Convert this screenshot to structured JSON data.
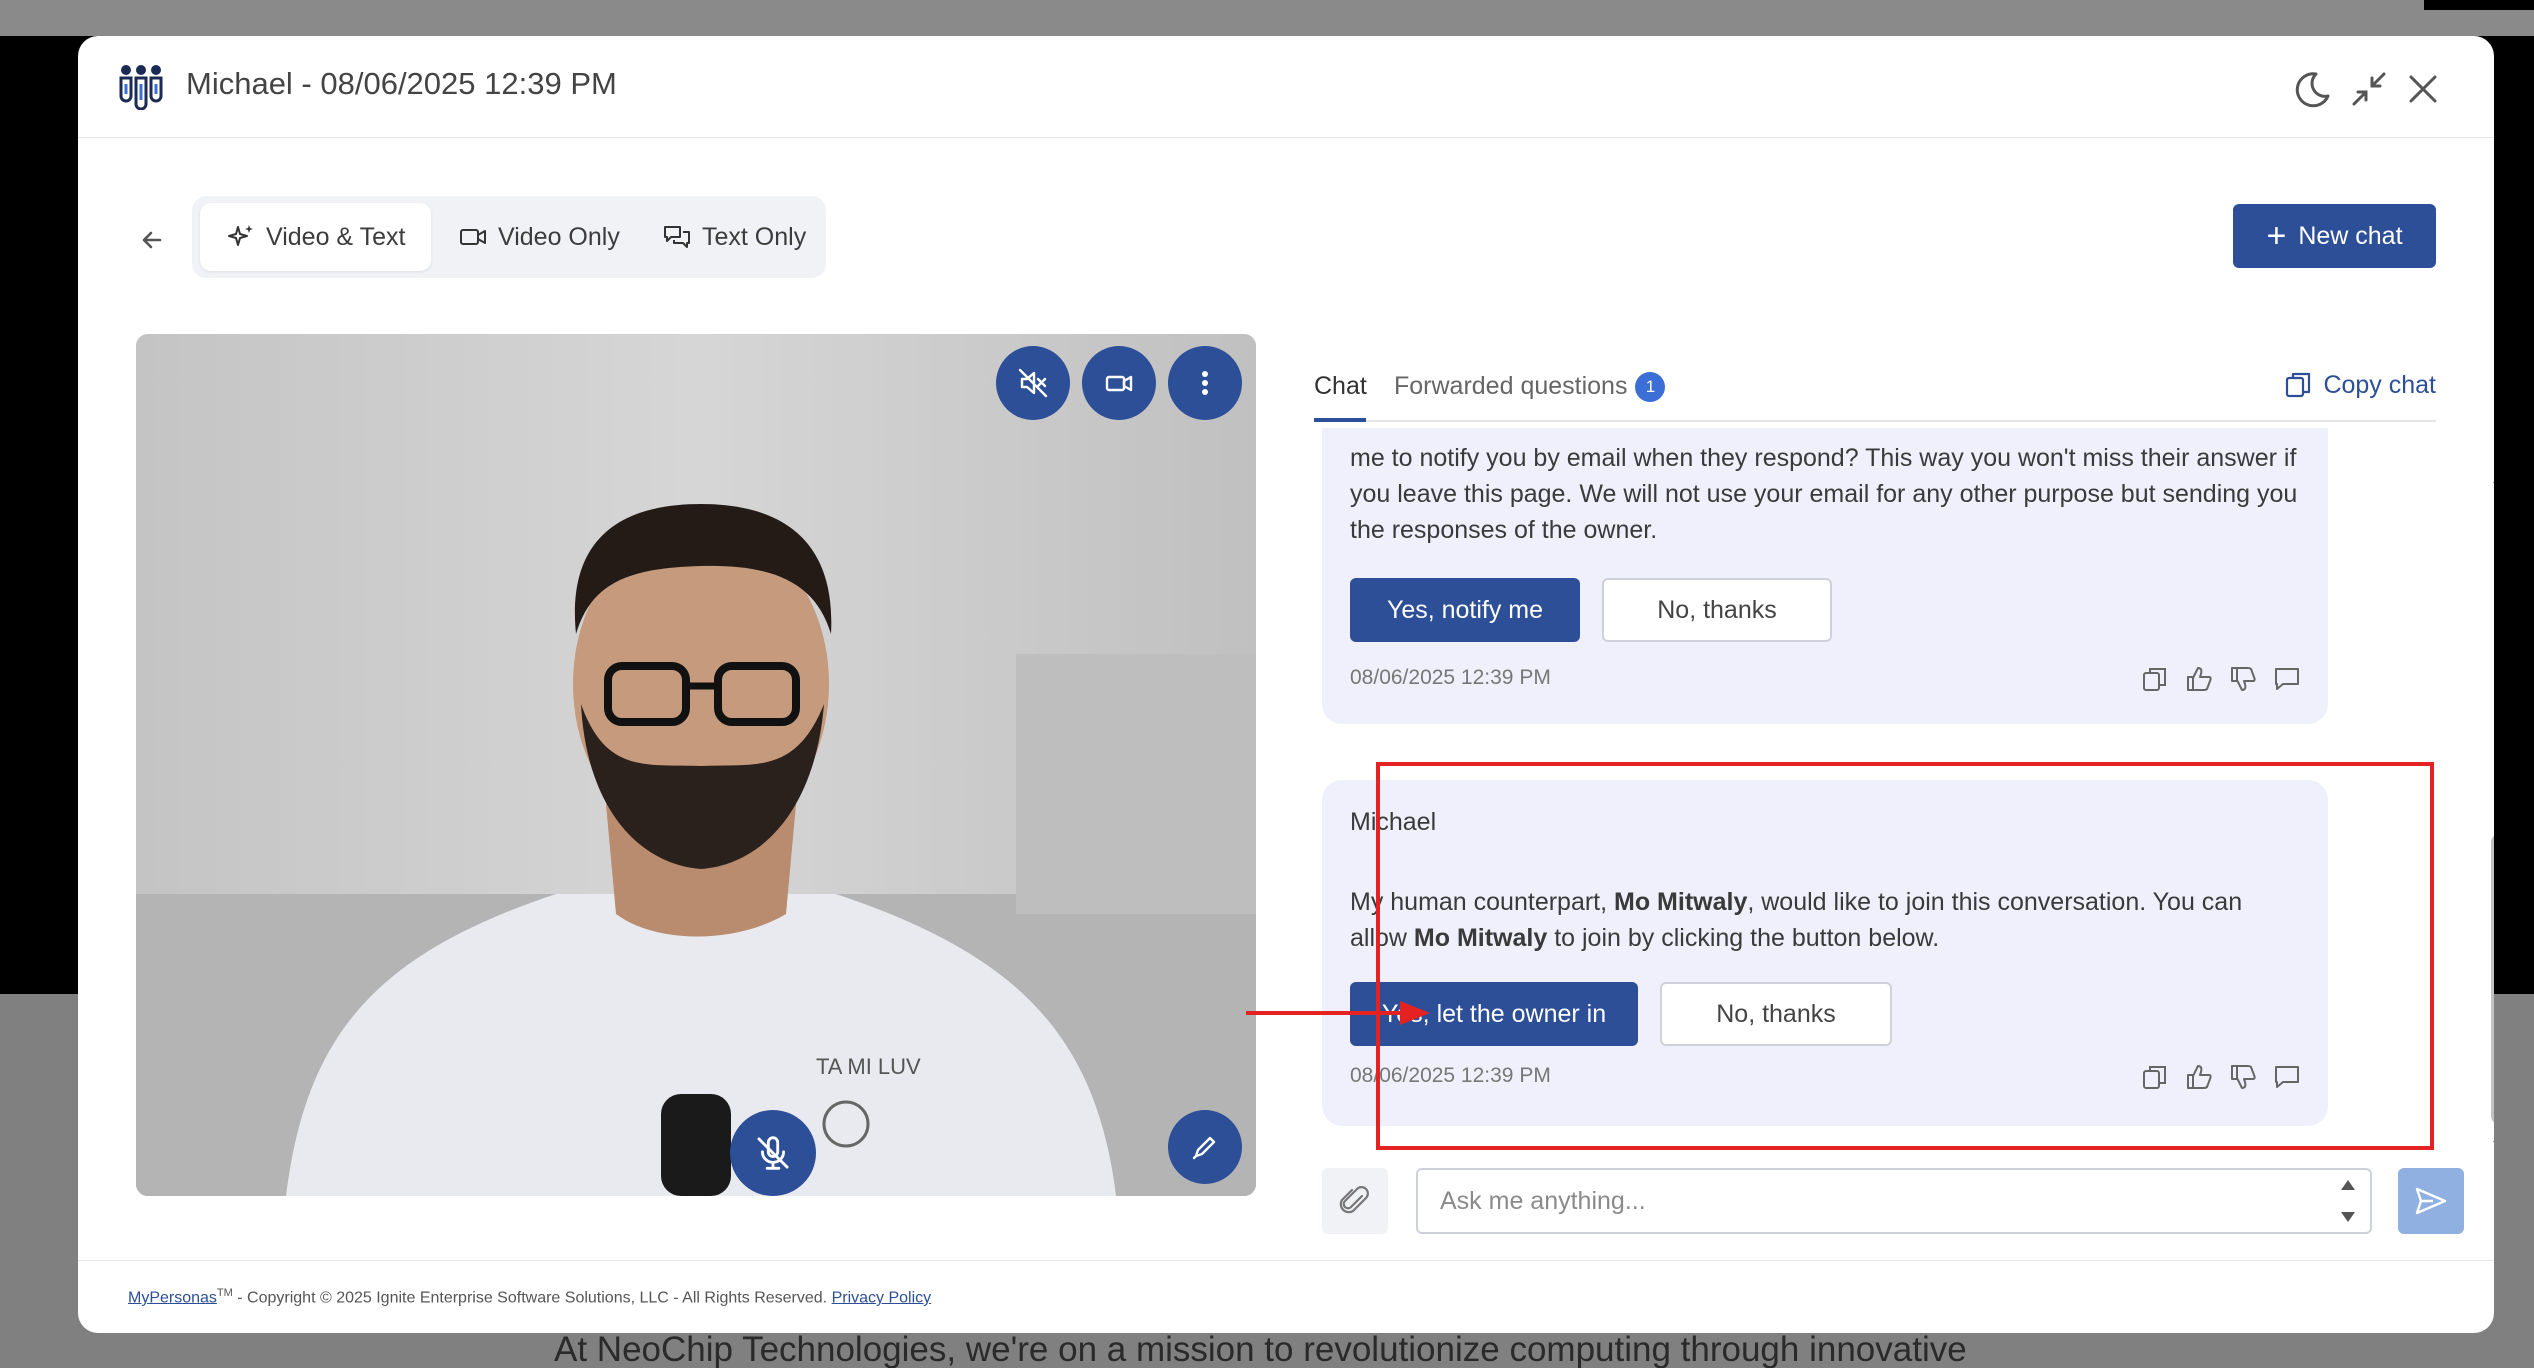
{
  "window": {
    "title": "Michael - 08/06/2025 12:39 PM"
  },
  "modes": [
    {
      "label": "Video & Text",
      "icon": "sparkles-icon",
      "active": true
    },
    {
      "label": "Video Only",
      "icon": "video-camera-icon",
      "active": false
    },
    {
      "label": "Text Only",
      "icon": "chat-bubbles-icon",
      "active": false
    }
  ],
  "new_chat_label": "New chat",
  "tabs": {
    "chat": "Chat",
    "forwarded": "Forwarded questions",
    "forwarded_count": "1",
    "copy_chat": "Copy chat"
  },
  "messages": [
    {
      "text_l0": "me to notify you by email when they respond? This way you won't miss their answer if",
      "text_l1": "you leave this page. We will not use your email for any other purpose but sending you",
      "text_l2": "the responses of the owner.",
      "primary": "Yes, notify me",
      "secondary": "No, thanks",
      "time": "08/06/2025 12:39 PM"
    },
    {
      "sender": "Michael",
      "l1_a": "My human counterpart, ",
      "l1_b": "Mo Mitwaly",
      "l1_c": ", would like to join this conversation. You can",
      "l2_a": "allow ",
      "l2_b": "Mo Mitwaly",
      "l2_c": " to join by clicking the button below.",
      "primary": "Yes, let the owner in",
      "secondary": "No, thanks",
      "time": "08/06/2025 12:39 PM"
    }
  ],
  "input": {
    "placeholder": "Ask me anything...",
    "value": ""
  },
  "footer": {
    "brand": "MyPersonas",
    "tm": "TM",
    "copyright": " - Copyright © 2025 Ignite Enterprise Software Solutions, LLC - All Rights Reserved. ",
    "privacy": "Privacy Policy"
  },
  "background_text": "At NeoChip Technologies, we're on a mission to revolutionize computing through innovative",
  "colors": {
    "primary": "#2c4f97",
    "bubble": "#eff0fb",
    "highlight": "#e52222",
    "send_disabled": "#8fb0e0"
  }
}
